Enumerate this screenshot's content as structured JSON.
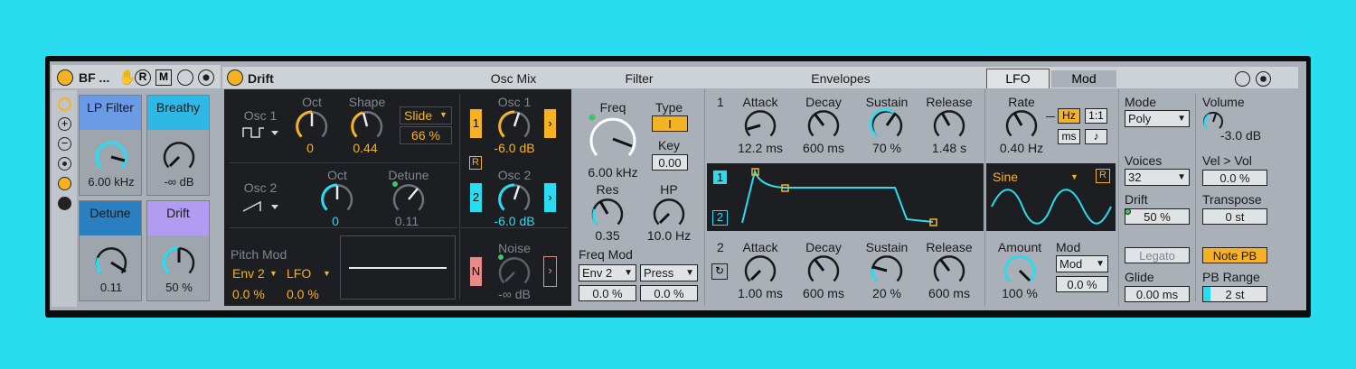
{
  "rack": {
    "title": "BF ...",
    "buttons": {
      "r": "R",
      "m": "M"
    },
    "macros": [
      {
        "label": "LP Filter",
        "value": "6.00 kHz",
        "color": "#6b9be6"
      },
      {
        "label": "Breathy",
        "value": "-∞ dB",
        "color": "#2fb8e6"
      },
      {
        "label": "Detune",
        "value": "0.11",
        "color": "#2a7fc0"
      },
      {
        "label": "Drift",
        "value": "50 %",
        "color": "#b09cf0"
      }
    ]
  },
  "device": {
    "title": "Drift",
    "sections": {
      "osc_mix": "Osc Mix",
      "filter": "Filter",
      "envelopes": "Envelopes"
    },
    "tabs": {
      "lfo": "LFO",
      "mod": "Mod"
    }
  },
  "osc": {
    "osc1_label": "Osc 1",
    "oct_label": "Oct",
    "oct1_value": "0",
    "shape_label": "Shape",
    "shape_value": "0.44",
    "shape_mode": "Slide",
    "shape_mode_value": "66 %",
    "osc2_label": "Osc 2",
    "oct2_value": "0",
    "detune_label": "Detune",
    "detune_value": "0.11",
    "pitchmod_label": "Pitch Mod",
    "pm_src1": "Env 2",
    "pm_src2": "LFO",
    "pm_val1": "0.0 %",
    "pm_val2": "0.0 %"
  },
  "mix": {
    "osc1_label": "Osc 1",
    "osc1_value": "-6.0 dB",
    "osc1_btn": "1",
    "r_btn": "R",
    "osc2_label": "Osc 2",
    "osc2_value": "-6.0 dB",
    "osc2_btn": "2",
    "noise_label": "Noise",
    "noise_value": "-∞ dB",
    "noise_btn": "N"
  },
  "filter": {
    "freq_label": "Freq",
    "freq_value": "6.00 kHz",
    "type_label": "Type",
    "type_value": "I",
    "key_label": "Key",
    "key_value": "0.00",
    "res_label": "Res",
    "res_value": "0.35",
    "hp_label": "HP",
    "hp_value": "10.0 Hz",
    "freqmod_label": "Freq Mod",
    "fm_src1": "Env 2",
    "fm_src2": "Press",
    "fm_val1": "0.0 %",
    "fm_val2": "0.0 %"
  },
  "env": {
    "env1_num": "1",
    "env2_num": "2",
    "attack_label": "Attack",
    "decay_label": "Decay",
    "sustain_label": "Sustain",
    "release_label": "Release",
    "env1": {
      "attack": "12.2 ms",
      "decay": "600 ms",
      "sustain": "70 %",
      "release": "1.48 s"
    },
    "env2": {
      "attack": "1.00 ms",
      "decay": "600 ms",
      "sustain": "20 %",
      "release": "600 ms"
    },
    "btn1": "1",
    "btn2": "2"
  },
  "lfo": {
    "rate_label": "Rate",
    "rate_value": "0.40 Hz",
    "hz": "Hz",
    "ratio": "1:1",
    "ms": "ms",
    "note": "♪",
    "wave": "Sine",
    "r_btn": "R",
    "amount_label": "Amount",
    "amount_value": "100 %",
    "mod_label": "Mod",
    "mod_src": "Mod",
    "mod_value": "0.0 %"
  },
  "global": {
    "mode_label": "Mode",
    "mode_value": "Poly",
    "voices_label": "Voices",
    "voices_value": "32",
    "drift_label": "Drift",
    "drift_value": "50 %",
    "legato": "Legato",
    "glide_label": "Glide",
    "glide_value": "0.00 ms",
    "volume_label": "Volume",
    "volume_value": "-3.0 dB",
    "velvol_label": "Vel > Vol",
    "velvol_value": "0.0 %",
    "transpose_label": "Transpose",
    "transpose_value": "0 st",
    "notepb": "Note PB",
    "pbrange_label": "PB Range",
    "pbrange_value": "2 st"
  },
  "colors": {
    "background": "#2adcf0",
    "accent_orange": "#f5b324",
    "accent_cyan": "#2adcf0",
    "panel_dark": "#1c1e21",
    "noise_pink": "#e88a8a"
  }
}
